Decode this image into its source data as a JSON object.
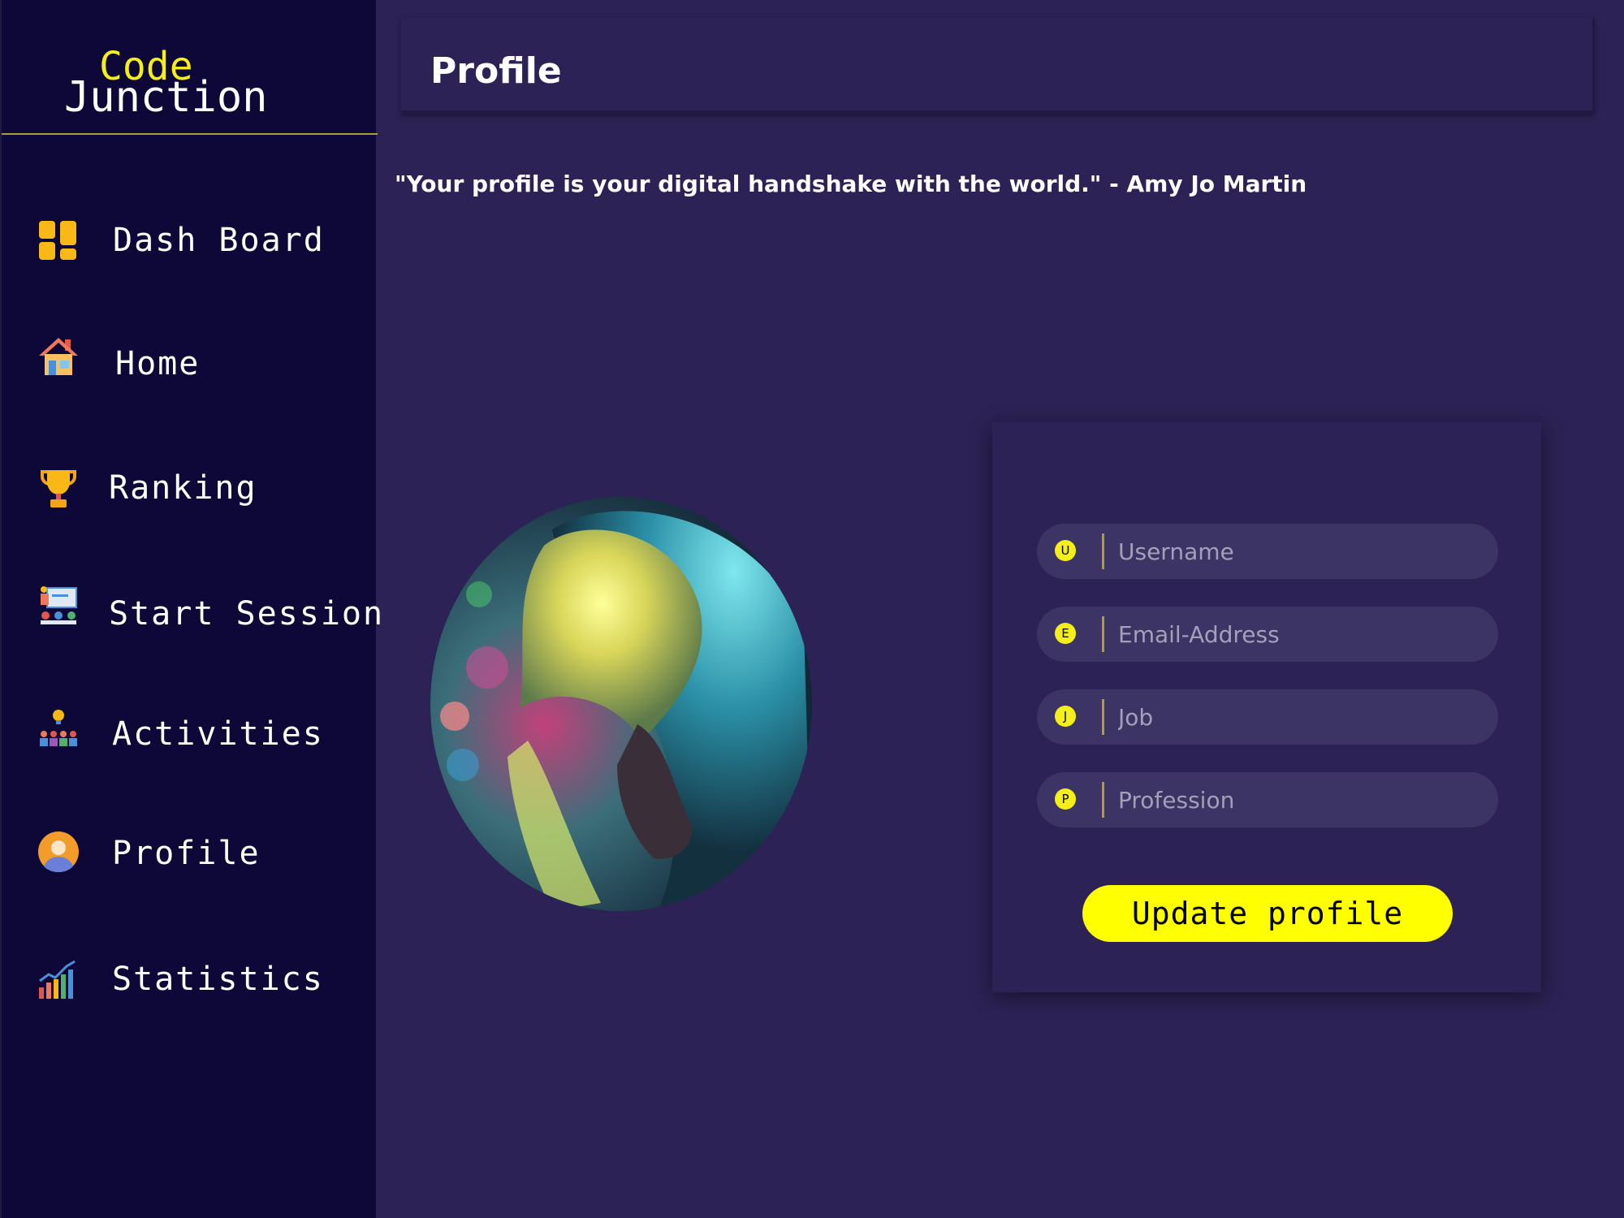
{
  "brand": {
    "part1": "Code",
    "part2": "Junction"
  },
  "sidebar": {
    "items": [
      {
        "label": "Dash Board",
        "icon": "dashboard-icon"
      },
      {
        "label": "Home",
        "icon": "home-icon"
      },
      {
        "label": "Ranking",
        "icon": "trophy-icon"
      },
      {
        "label": "Start Session",
        "icon": "presentation-icon"
      },
      {
        "label": "Activities",
        "icon": "team-idea-icon"
      },
      {
        "label": "Profile",
        "icon": "user-icon"
      },
      {
        "label": "Statistics",
        "icon": "bar-chart-icon"
      }
    ]
  },
  "header": {
    "title": "Profile"
  },
  "quote": "\"Your profile is your digital handshake with the world.\" - Amy Jo Martin",
  "form": {
    "fields": [
      {
        "badge": "U",
        "placeholder": "Username",
        "value": ""
      },
      {
        "badge": "E",
        "placeholder": "Email-Address",
        "value": ""
      },
      {
        "badge": "J",
        "placeholder": "Job",
        "value": ""
      },
      {
        "badge": "P",
        "placeholder": "Profession",
        "value": ""
      }
    ],
    "submit_label": "Update profile"
  },
  "colors": {
    "sidebar_bg": "#0d0838",
    "main_bg": "#2c2255",
    "accent": "#ffff00",
    "field_bg": "#3c3464"
  }
}
